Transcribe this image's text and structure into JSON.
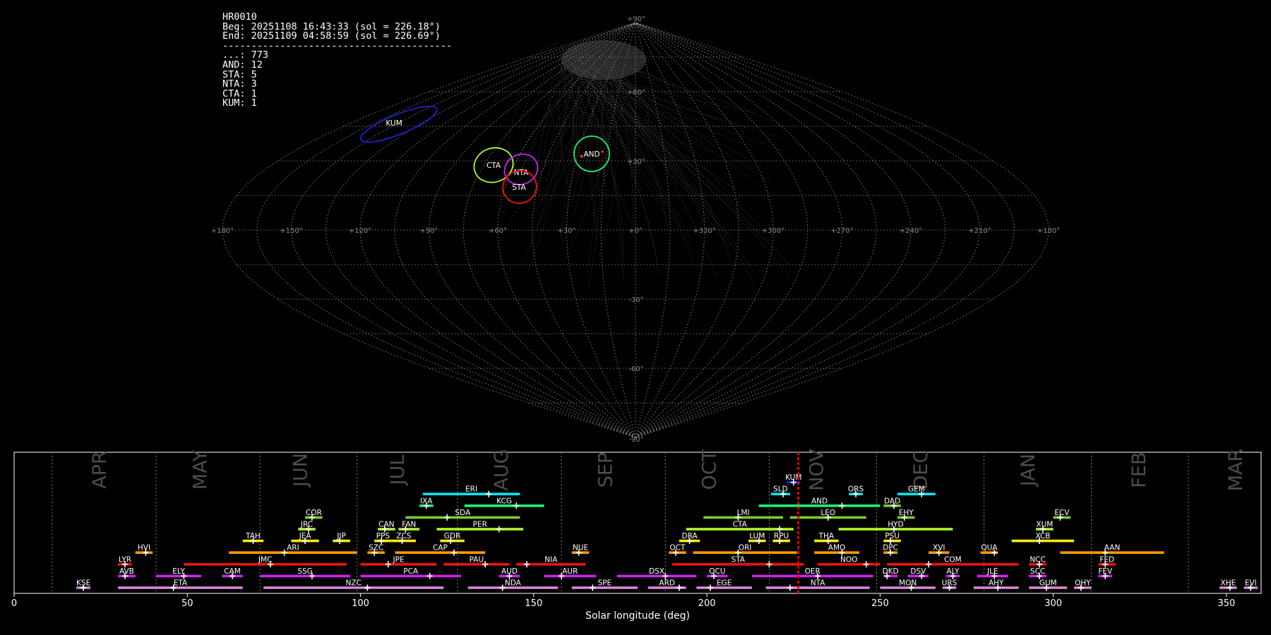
{
  "info_header": {
    "id": "HR0010",
    "beg": "Beg: 20251108 16:43:33 (sol = 226.18°)",
    "end": "End: 20251109 04:58:59 (sol = 226.69°)",
    "separator": "----------------------------------------",
    "counts": [
      "...: 773",
      "AND: 12",
      "STA: 5",
      "NTA: 3",
      "CTA: 1",
      "KUM: 1"
    ]
  },
  "colors": {
    "background": "#000000",
    "grid": "#9a9a9a",
    "KUM": "#1f1fcc",
    "CTA": "#adff2f",
    "NTA": "#cc22ee",
    "STA": "#ee1111",
    "AND": "#22ee77"
  },
  "chart_data": [
    {
      "type": "scatter",
      "name": "sky-map",
      "projection": "sinusoidal (radiant sky map)",
      "lon_ticks": [
        "+180°",
        "+150°",
        "+120°",
        "+90°",
        "+60°",
        "+30°",
        "+0°",
        "+330°",
        "+300°",
        "+270°",
        "+240°",
        "+210°",
        "+180°"
      ],
      "lat_ticks": [
        "+90°",
        "+60°",
        "+30°",
        "-30°",
        "-60°",
        "-90°"
      ],
      "shower_ellipses": [
        {
          "code": "KUM",
          "color": "#1f1fcc"
        },
        {
          "code": "CTA",
          "color": "#adff2f"
        },
        {
          "code": "NTA",
          "color": "#cc22ee"
        },
        {
          "code": "STA",
          "color": "#ee1111"
        },
        {
          "code": "AND",
          "color": "#22ee77"
        }
      ],
      "grid": true
    },
    {
      "type": "bar",
      "name": "shower-activity-timeline",
      "xlabel": "Solar longitude (deg)",
      "xlim": [
        0,
        360
      ],
      "xticks": [
        0,
        50,
        100,
        150,
        200,
        250,
        300,
        350
      ],
      "current_sol": 226.4,
      "months": [
        {
          "label": "APR",
          "start": 11,
          "mid": 25
        },
        {
          "label": "MAY",
          "start": 41,
          "mid": 54
        },
        {
          "label": "JUN",
          "start": 71,
          "mid": 83
        },
        {
          "label": "JUL",
          "start": 99,
          "mid": 111
        },
        {
          "label": "AUG",
          "start": 128,
          "mid": 141
        },
        {
          "label": "SEP",
          "start": 158,
          "mid": 171
        },
        {
          "label": "OCT",
          "start": 188,
          "mid": 201
        },
        {
          "label": "NOV",
          "start": 218,
          "mid": 232
        },
        {
          "label": "DEC",
          "start": 249,
          "mid": 262
        },
        {
          "label": "JAN",
          "start": 280,
          "mid": 293
        },
        {
          "label": "FEB",
          "start": 311,
          "mid": 325
        },
        {
          "label": "MAR",
          "start": 339,
          "mid": 353
        }
      ],
      "showers": [
        {
          "code": "KUM",
          "row": 10,
          "start": 223,
          "end": 227,
          "peak": 225,
          "color": "#1f1fcc"
        },
        {
          "code": "ERI",
          "row": 9,
          "start": 118,
          "end": 146,
          "peak": 137,
          "color": "#00e5ee"
        },
        {
          "code": "SLD",
          "row": 9,
          "start": 218.5,
          "end": 224,
          "peak": 222,
          "color": "#00e5ee"
        },
        {
          "code": "ORS",
          "row": 9,
          "start": 241,
          "end": 245,
          "peak": 243,
          "color": "#00e5ee"
        },
        {
          "code": "GEM",
          "row": 9,
          "start": 255,
          "end": 266,
          "peak": 262,
          "color": "#00e5ee"
        },
        {
          "code": "IXA",
          "row": 8,
          "start": 117,
          "end": 121,
          "peak": 119,
          "color": "#22ee77"
        },
        {
          "code": "KCG",
          "row": 8,
          "start": 130,
          "end": 153,
          "peak": 145,
          "color": "#22ee77"
        },
        {
          "code": "AND",
          "row": 8,
          "start": 215,
          "end": 250,
          "peak": 239,
          "color": "#22ee77"
        },
        {
          "code": "DAD",
          "row": 8,
          "start": 251,
          "end": 256,
          "peak": 254,
          "color": "#7ccd2a"
        },
        {
          "code": "SDA",
          "row": 7,
          "start": 113,
          "end": 146,
          "peak": 125,
          "color": "#7ccd2a"
        },
        {
          "code": "COR",
          "row": 7,
          "start": 84,
          "end": 89,
          "peak": 86,
          "color": "#7ccd2a"
        },
        {
          "code": "LMI",
          "row": 7,
          "start": 199,
          "end": 222,
          "peak": 209,
          "color": "#7ccd2a"
        },
        {
          "code": "LEO",
          "row": 7,
          "start": 224,
          "end": 246,
          "peak": 235,
          "color": "#7ccd2a"
        },
        {
          "code": "EHY",
          "row": 7,
          "start": 255,
          "end": 260,
          "peak": 257,
          "color": "#7ccd2a"
        },
        {
          "code": "ECV",
          "row": 7,
          "start": 300,
          "end": 305,
          "peak": 302,
          "color": "#7ccd2a"
        },
        {
          "code": "JRC",
          "row": 6,
          "start": 82,
          "end": 87,
          "peak": 85,
          "color": "#adff2f"
        },
        {
          "code": "CAN",
          "row": 6,
          "start": 105,
          "end": 110,
          "peak": 107,
          "color": "#adff2f"
        },
        {
          "code": "FAN",
          "row": 6,
          "start": 111,
          "end": 117,
          "peak": 113,
          "color": "#adff2f"
        },
        {
          "code": "PER",
          "row": 6,
          "start": 122,
          "end": 147,
          "peak": 140,
          "color": "#adff2f"
        },
        {
          "code": "CTA",
          "row": 6,
          "start": 194,
          "end": 225,
          "peak": 221,
          "color": "#adff2f"
        },
        {
          "code": "HYD",
          "row": 6,
          "start": 238,
          "end": 271,
          "peak": 254,
          "color": "#adff2f"
        },
        {
          "code": "XUM",
          "row": 6,
          "start": 295,
          "end": 300,
          "peak": 297,
          "color": "#adff2f"
        },
        {
          "code": "TAH",
          "row": 5,
          "start": 66,
          "end": 72,
          "peak": 69,
          "color": "#ffee00"
        },
        {
          "code": "JEA",
          "row": 5,
          "start": 80,
          "end": 88,
          "peak": 84,
          "color": "#ffee00"
        },
        {
          "code": "JJP",
          "row": 5,
          "start": 92,
          "end": 97,
          "peak": 94,
          "color": "#ffee00"
        },
        {
          "code": "PPS",
          "row": 5,
          "start": 104,
          "end": 109,
          "peak": 106,
          "color": "#ffee00"
        },
        {
          "code": "ZCS",
          "row": 5,
          "start": 109,
          "end": 116,
          "peak": 112,
          "color": "#ffee00"
        },
        {
          "code": "GDR",
          "row": 5,
          "start": 123,
          "end": 130,
          "peak": 126,
          "color": "#ffee00"
        },
        {
          "code": "DRA",
          "row": 5,
          "start": 192,
          "end": 198,
          "peak": 195,
          "color": "#ffee00"
        },
        {
          "code": "LUM",
          "row": 5,
          "start": 212,
          "end": 217,
          "peak": 215,
          "color": "#ffee00"
        },
        {
          "code": "RPU",
          "row": 5,
          "start": 219,
          "end": 224,
          "peak": 221,
          "color": "#ffee00"
        },
        {
          "code": "THA",
          "row": 5,
          "start": 231,
          "end": 238,
          "peak": 235,
          "color": "#ffee00"
        },
        {
          "code": "PSU",
          "row": 5,
          "start": 251,
          "end": 256,
          "peak": 253,
          "color": "#ffee00"
        },
        {
          "code": "XCB",
          "row": 5,
          "start": 288,
          "end": 306,
          "peak": 296,
          "color": "#ffee00"
        },
        {
          "code": "HVI",
          "row": 4,
          "start": 35,
          "end": 40,
          "peak": 38,
          "color": "#ff9900"
        },
        {
          "code": "ARI",
          "row": 4,
          "start": 62,
          "end": 99,
          "peak": 78,
          "color": "#ff9900"
        },
        {
          "code": "SZC",
          "row": 4,
          "start": 102,
          "end": 107,
          "peak": 104,
          "color": "#ff9900"
        },
        {
          "code": "CAP",
          "row": 4,
          "start": 110,
          "end": 136,
          "peak": 127,
          "color": "#ff9900"
        },
        {
          "code": "NUE",
          "row": 4,
          "start": 161,
          "end": 166,
          "peak": 163,
          "color": "#ff9900"
        },
        {
          "code": "OCT",
          "row": 4,
          "start": 189,
          "end": 194,
          "peak": 191,
          "color": "#ff9900"
        },
        {
          "code": "ORI",
          "row": 4,
          "start": 196,
          "end": 226,
          "peak": 209,
          "color": "#ff9900"
        },
        {
          "code": "AMO",
          "row": 4,
          "start": 231,
          "end": 244,
          "peak": 239,
          "color": "#ff9900"
        },
        {
          "code": "DPC",
          "row": 4,
          "start": 251,
          "end": 255,
          "peak": 253,
          "color": "#ff9900"
        },
        {
          "code": "XVI",
          "row": 4,
          "start": 264,
          "end": 270,
          "peak": 267,
          "color": "#ff9900"
        },
        {
          "code": "QUA",
          "row": 4,
          "start": 279,
          "end": 284,
          "peak": 283,
          "color": "#ff9900"
        },
        {
          "code": "AAN",
          "row": 4,
          "start": 302,
          "end": 332,
          "peak": 315,
          "color": "#ff9900"
        },
        {
          "code": "LYR",
          "row": 3,
          "start": 30,
          "end": 34,
          "peak": 32,
          "color": "#ee1111"
        },
        {
          "code": "JMC",
          "row": 3,
          "start": 49,
          "end": 96,
          "peak": 74,
          "color": "#ee1111"
        },
        {
          "code": "JPE",
          "row": 3,
          "start": 100,
          "end": 122,
          "peak": 108,
          "color": "#ee1111"
        },
        {
          "code": "PAU",
          "row": 3,
          "start": 124,
          "end": 143,
          "peak": 136,
          "color": "#ee1111"
        },
        {
          "code": "NIA",
          "row": 3,
          "start": 145,
          "end": 165,
          "peak": 148,
          "color": "#ee1111"
        },
        {
          "code": "STA",
          "row": 3,
          "start": 190,
          "end": 228,
          "peak": 218,
          "color": "#ee1111"
        },
        {
          "code": "NOO",
          "row": 3,
          "start": 232,
          "end": 250,
          "peak": 246,
          "color": "#ee1111"
        },
        {
          "code": "COM",
          "row": 3,
          "start": 252,
          "end": 290,
          "peak": 264,
          "color": "#ee1111"
        },
        {
          "code": "NCC",
          "row": 3,
          "start": 293,
          "end": 298,
          "peak": 296,
          "color": "#ee1111"
        },
        {
          "code": "FED",
          "row": 3,
          "start": 313,
          "end": 318,
          "peak": 315,
          "color": "#ee1111"
        },
        {
          "code": "AVB",
          "row": 2,
          "start": 30,
          "end": 35,
          "peak": 32,
          "color": "#cc22ee"
        },
        {
          "code": "ELY",
          "row": 2,
          "start": 41,
          "end": 54,
          "peak": 49,
          "color": "#cc22ee"
        },
        {
          "code": "CAM",
          "row": 2,
          "start": 60,
          "end": 66,
          "peak": 63,
          "color": "#cc22ee"
        },
        {
          "code": "SSG",
          "row": 2,
          "start": 71,
          "end": 97,
          "peak": 86,
          "color": "#cc22ee"
        },
        {
          "code": "PCA",
          "row": 2,
          "start": 100,
          "end": 129,
          "peak": 120,
          "color": "#cc22ee"
        },
        {
          "code": "AUD",
          "row": 2,
          "start": 140,
          "end": 146,
          "peak": 143,
          "color": "#cc22ee"
        },
        {
          "code": "AUR",
          "row": 2,
          "start": 153,
          "end": 168,
          "peak": 158,
          "color": "#cc22ee"
        },
        {
          "code": "DSX",
          "row": 2,
          "start": 174,
          "end": 197,
          "peak": 188,
          "color": "#cc22ee"
        },
        {
          "code": "OCU",
          "row": 2,
          "start": 200,
          "end": 206,
          "peak": 202,
          "color": "#cc22ee"
        },
        {
          "code": "OER",
          "row": 2,
          "start": 213,
          "end": 248,
          "peak": 232,
          "color": "#cc22ee"
        },
        {
          "code": "DKD",
          "row": 2,
          "start": 251,
          "end": 255,
          "peak": 252,
          "color": "#cc22ee"
        },
        {
          "code": "DSV",
          "row": 2,
          "start": 258,
          "end": 264,
          "peak": 262,
          "color": "#cc22ee"
        },
        {
          "code": "ALY",
          "row": 2,
          "start": 269,
          "end": 273,
          "peak": 271,
          "color": "#cc22ee"
        },
        {
          "code": "JLE",
          "row": 2,
          "start": 278,
          "end": 287,
          "peak": 283,
          "color": "#cc22ee"
        },
        {
          "code": "SCC",
          "row": 2,
          "start": 293,
          "end": 298,
          "peak": 296,
          "color": "#cc22ee"
        },
        {
          "code": "FEV",
          "row": 2,
          "start": 313,
          "end": 317,
          "peak": 315,
          "color": "#cc22ee"
        },
        {
          "code": "KSE",
          "row": 1,
          "start": 18,
          "end": 22,
          "peak": 20,
          "color": "#dd88dd"
        },
        {
          "code": "ETA",
          "row": 1,
          "start": 30,
          "end": 66,
          "peak": 46,
          "color": "#dd88dd"
        },
        {
          "code": "NZC",
          "row": 1,
          "start": 72,
          "end": 124,
          "peak": 102,
          "color": "#dd88dd"
        },
        {
          "code": "NDA",
          "row": 1,
          "start": 131,
          "end": 157,
          "peak": 141,
          "color": "#dd88dd"
        },
        {
          "code": "SPE",
          "row": 1,
          "start": 161,
          "end": 180,
          "peak": 167,
          "color": "#dd88dd"
        },
        {
          "code": "ARD",
          "row": 1,
          "start": 183,
          "end": 194,
          "peak": 192,
          "color": "#dd88dd"
        },
        {
          "code": "EGE",
          "row": 1,
          "start": 197,
          "end": 213,
          "peak": 201,
          "color": "#dd88dd"
        },
        {
          "code": "NTA",
          "row": 1,
          "start": 217,
          "end": 247,
          "peak": 224,
          "color": "#dd88dd"
        },
        {
          "code": "MON",
          "row": 1,
          "start": 250,
          "end": 266,
          "peak": 259,
          "color": "#dd88dd"
        },
        {
          "code": "URS",
          "row": 1,
          "start": 268,
          "end": 272,
          "peak": 270,
          "color": "#dd88dd"
        },
        {
          "code": "AHY",
          "row": 1,
          "start": 277,
          "end": 290,
          "peak": 284,
          "color": "#dd88dd"
        },
        {
          "code": "GUM",
          "row": 1,
          "start": 293,
          "end": 304,
          "peak": 298,
          "color": "#dd88dd"
        },
        {
          "code": "OHY",
          "row": 1,
          "start": 306,
          "end": 311,
          "peak": 308,
          "color": "#dd88dd"
        },
        {
          "code": "XHE",
          "row": 1,
          "start": 348,
          "end": 353,
          "peak": 351,
          "color": "#dd88dd"
        },
        {
          "code": "EVI",
          "row": 1,
          "start": 355,
          "end": 359,
          "peak": 357,
          "color": "#dd88dd"
        }
      ]
    }
  ]
}
